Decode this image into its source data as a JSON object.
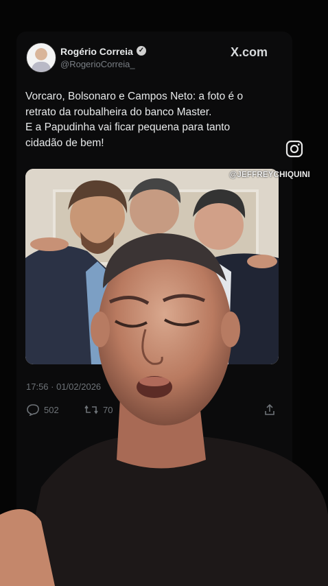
{
  "tweet": {
    "author_name": "Rogério Correia",
    "handle": "@RogerioCorreia_",
    "source": "X.com",
    "text_lines": [
      "Vorcaro, Bolsonaro e Campos Neto: a foto é o",
      "retrato da roubalheira do banco Master.",
      "E a Papudinha vai ficar pequena para tanto",
      "cidadão de bem!"
    ],
    "timestamp": "17:56 · 01/02/2026",
    "replies": "502",
    "retweets": "70"
  },
  "overlay": {
    "watermark": "@JEFFREYCHIQUINI",
    "instagram_icon": "instagram-icon"
  },
  "colors": {
    "background": "#050505",
    "card": "#0b0b0c",
    "text": "#e7e9ea",
    "muted": "#6e7378"
  }
}
